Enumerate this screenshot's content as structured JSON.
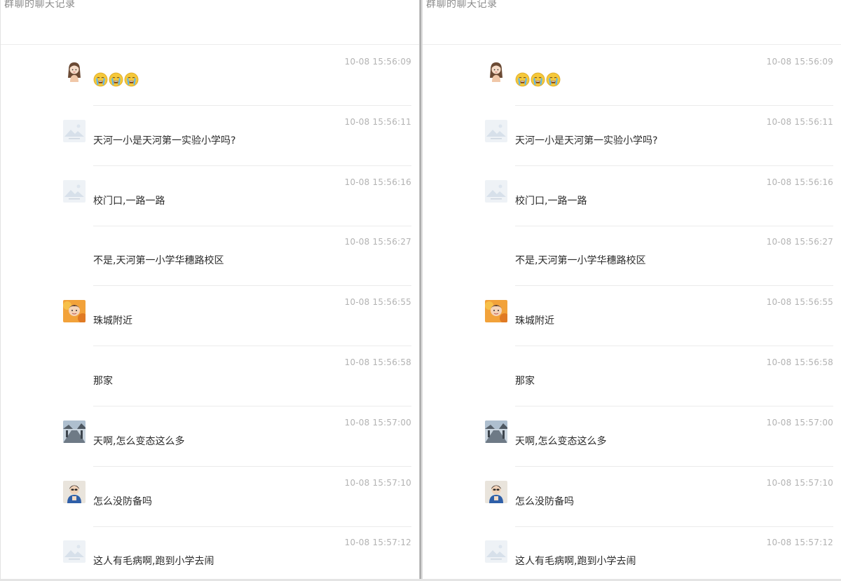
{
  "header": {
    "title": "群聊的聊天记录"
  },
  "messages": [
    {
      "avatar": "girl-avatar",
      "nick": "",
      "time": "10-08 15:56:09",
      "type": "emoji",
      "emojis": [
        "crying-face-icon",
        "crying-face-icon",
        "crying-face-icon"
      ],
      "text": ""
    },
    {
      "avatar": "image-placeholder-avatar",
      "nick": "",
      "time": "10-08 15:56:11",
      "type": "text",
      "text": "天河一小是天河第一实验小学吗?"
    },
    {
      "avatar": "image-placeholder-avatar",
      "nick": "",
      "time": "10-08 15:56:16",
      "type": "text",
      "text": "校门口,一路一路"
    },
    {
      "avatar": "",
      "nick": "",
      "time": "10-08 15:56:27",
      "type": "text",
      "text": "不是,天河第一小学华穗路校区"
    },
    {
      "avatar": "photo-avatar-orange",
      "nick": "",
      "time": "10-08 15:56:55",
      "type": "text",
      "text": "珠城附近"
    },
    {
      "avatar": "",
      "nick": "",
      "time": "10-08 15:56:58",
      "type": "text",
      "text": "那家"
    },
    {
      "avatar": "photo-avatar-street",
      "nick": "",
      "time": "10-08 15:57:00",
      "type": "text",
      "text": "天啊,怎么变态这么多"
    },
    {
      "avatar": "photo-avatar-person",
      "nick": "",
      "time": "10-08 15:57:10",
      "type": "text",
      "text": "怎么没防备吗"
    },
    {
      "avatar": "image-placeholder-avatar",
      "nick": "",
      "time": "10-08 15:57:12",
      "type": "text",
      "text": "这人有毛病啊,跑到小学去闹"
    }
  ],
  "colors": {
    "time": "#b3b3b3",
    "text": "#2a2a2a",
    "separator": "#ebebeb",
    "header_title": "#8a8a8a"
  }
}
